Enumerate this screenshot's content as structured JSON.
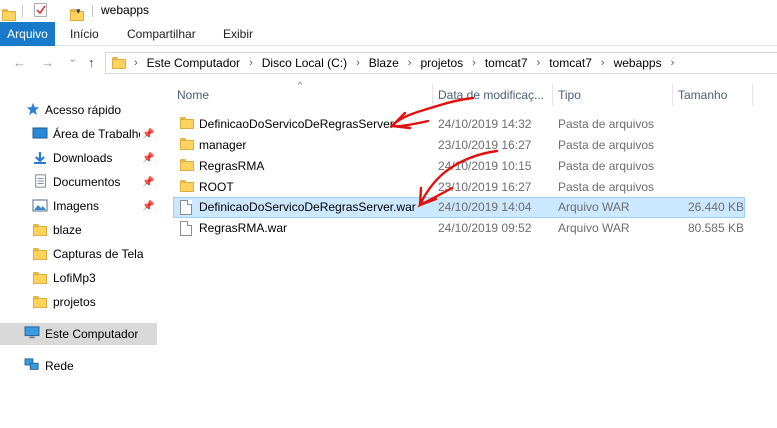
{
  "titlebar": {
    "title": "webapps",
    "dropdown_glyph": "▾",
    "icons": [
      "folder-icon",
      "properties-check-icon",
      "new-folder-icon",
      "customize-dropdown-icon"
    ]
  },
  "ribbon": {
    "tabs": [
      "Arquivo",
      "Início",
      "Compartilhar",
      "Exibir"
    ],
    "accent": "#1979ca"
  },
  "nav": {
    "back": "←",
    "forward": "→",
    "recent": "⌄",
    "up": "↑"
  },
  "address": {
    "crumbs": [
      "Este Computador",
      "Disco Local (C:)",
      "Blaze",
      "projetos",
      "tomcat7",
      "tomcat7",
      "webapps"
    ],
    "separator": "›"
  },
  "sidebar": {
    "quick_access": "Acesso rápido",
    "items": [
      {
        "label": "Área de Trabalho",
        "icon": "desktop-icon",
        "pinned": true
      },
      {
        "label": "Downloads",
        "icon": "download-icon",
        "pinned": true
      },
      {
        "label": "Documentos",
        "icon": "documents-icon",
        "pinned": true
      },
      {
        "label": "Imagens",
        "icon": "pictures-icon",
        "pinned": true
      },
      {
        "label": "blaze",
        "icon": "folder-icon",
        "pinned": false
      },
      {
        "label": "Capturas de Tela",
        "icon": "folder-icon",
        "pinned": false
      },
      {
        "label": "LofiMp3",
        "icon": "folder-icon",
        "pinned": false
      },
      {
        "label": "projetos",
        "icon": "folder-icon",
        "pinned": false
      }
    ],
    "this_pc": "Este Computador",
    "network": "Rede",
    "pin_glyph": "📌"
  },
  "filelist": {
    "sort_glyph": "^",
    "columns": [
      "Nome",
      "Data de modificaç...",
      "Tipo",
      "Tamanho"
    ],
    "rows": [
      {
        "name": "DefinicaoDoServicoDeRegrasServer",
        "date": "24/10/2019 14:32",
        "type": "Pasta de arquivos",
        "size": "",
        "kind": "folder",
        "selected": false
      },
      {
        "name": "manager",
        "date": "23/10/2019 16:27",
        "type": "Pasta de arquivos",
        "size": "",
        "kind": "folder",
        "selected": false
      },
      {
        "name": "RegrasRMA",
        "date": "24/10/2019 10:15",
        "type": "Pasta de arquivos",
        "size": "",
        "kind": "folder",
        "selected": false
      },
      {
        "name": "ROOT",
        "date": "23/10/2019 16:27",
        "type": "Pasta de arquivos",
        "size": "",
        "kind": "folder",
        "selected": false
      },
      {
        "name": "DefinicaoDoServicoDeRegrasServer.war",
        "date": "24/10/2019 14:04",
        "type": "Arquivo WAR",
        "size": "26.440 KB",
        "kind": "file",
        "selected": true
      },
      {
        "name": "RegrasRMA.war",
        "date": "24/10/2019 09:52",
        "type": "Arquivo WAR",
        "size": "80.585 KB",
        "kind": "file",
        "selected": false
      }
    ]
  },
  "colors": {
    "selection": "#cce8ff",
    "header_text": "#4c607a",
    "annotation": "#e01010"
  }
}
